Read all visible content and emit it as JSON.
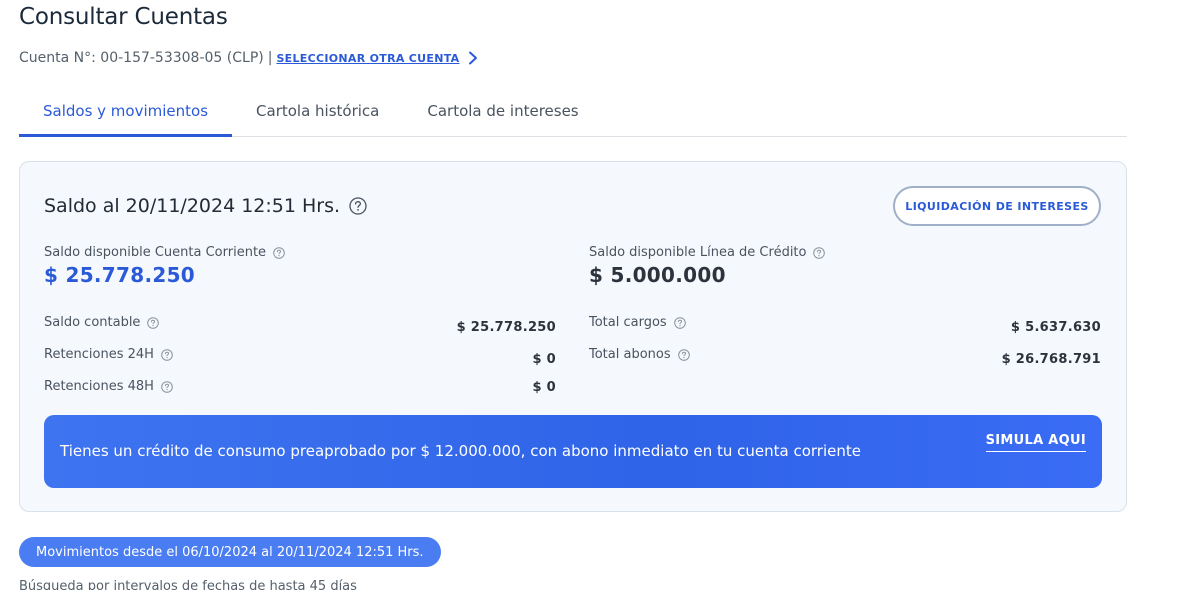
{
  "page": {
    "title": "Consultar Cuentas"
  },
  "account": {
    "label": "Cuenta N°: 00-157-53308-05 (CLP)",
    "separator": "|",
    "select_other": "SELECCIONAR OTRA CUENTA",
    "select_icon": "chevron-right-icon"
  },
  "tabs": [
    {
      "label": "Saldos y movimientos",
      "active": true
    },
    {
      "label": "Cartola histórica",
      "active": false
    },
    {
      "label": "Cartola de intereses",
      "active": false
    }
  ],
  "balance": {
    "title": "Saldo al 20/11/2024 12:51 Hrs.",
    "help_icon": "question-circle-icon",
    "liquidation_button": "LIQUIDACIÓN DE INTERESES",
    "available_checking": {
      "label": "Saldo disponible Cuenta Corriente",
      "amount": "$ 25.778.250"
    },
    "available_credit": {
      "label": "Saldo disponible Línea de Crédito",
      "amount": "$ 5.000.000"
    },
    "left_rows": [
      {
        "label": "Saldo contable",
        "value": "$ 25.778.250"
      },
      {
        "label": "Retenciones 24H",
        "value": "$ 0"
      },
      {
        "label": "Retenciones 48H",
        "value": "$ 0"
      }
    ],
    "right_rows": [
      {
        "label": "Total cargos",
        "value": "$ 5.637.630"
      },
      {
        "label": "Total abonos",
        "value": "$ 26.768.791"
      }
    ]
  },
  "promo": {
    "text": "Tienes un crédito de consumo preaprobado por $ 12.000.000, con abono inmediato en tu cuenta corriente",
    "link": "SIMULA AQUI"
  },
  "movements": {
    "range_label": "Movimientos desde el 06/10/2024 al 20/11/2024 12:51 Hrs.",
    "search_note": "Búsqueda por intervalos de fechas de hasta 45 días"
  },
  "colors": {
    "accent": "#2a5ad8",
    "promo_bg": "#3e74f0",
    "card_bg": "#f5f8fc"
  }
}
